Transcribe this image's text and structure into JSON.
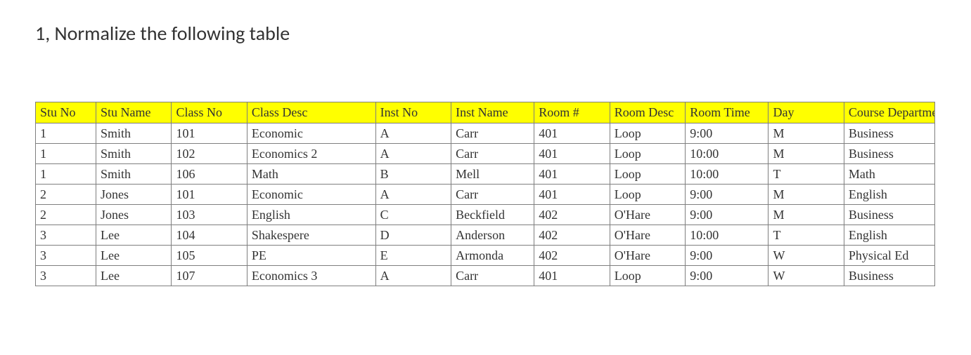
{
  "title": "1, Normalize the following table",
  "headers": [
    "Stu No",
    "Stu Name",
    "Class No",
    "Class Desc",
    "Inst No",
    "Inst Name",
    "Room #",
    "Room Desc",
    "Room Time",
    "Day",
    "Course Department"
  ],
  "rows": [
    {
      "stu_no": "1",
      "stu_name": "Smith",
      "class_no": "101",
      "class_desc": "Economic",
      "inst_no": "A",
      "inst_name": "Carr",
      "room_num": "401",
      "room_desc": "Loop",
      "room_time": "9:00",
      "day": "M",
      "course_dept": "Business"
    },
    {
      "stu_no": "1",
      "stu_name": "Smith",
      "class_no": "102",
      "class_desc": "Economics 2",
      "inst_no": "A",
      "inst_name": "Carr",
      "room_num": "401",
      "room_desc": "Loop",
      "room_time": "10:00",
      "day": "M",
      "course_dept": "Business"
    },
    {
      "stu_no": "1",
      "stu_name": "Smith",
      "class_no": "106",
      "class_desc": "Math",
      "inst_no": "B",
      "inst_name": "Mell",
      "room_num": "401",
      "room_desc": "Loop",
      "room_time": "10:00",
      "day": "T",
      "course_dept": "Math"
    },
    {
      "stu_no": "2",
      "stu_name": "Jones",
      "class_no": "101",
      "class_desc": "Economic",
      "inst_no": "A",
      "inst_name": "Carr",
      "room_num": "401",
      "room_desc": "Loop",
      "room_time": "9:00",
      "day": "M",
      "course_dept": "English"
    },
    {
      "stu_no": "2",
      "stu_name": "Jones",
      "class_no": "103",
      "class_desc": "English",
      "inst_no": "C",
      "inst_name": "Beckfield",
      "room_num": "402",
      "room_desc": "O'Hare",
      "room_time": "9:00",
      "day": "M",
      "course_dept": "Business"
    },
    {
      "stu_no": "3",
      "stu_name": "Lee",
      "class_no": "104",
      "class_desc": "Shakespere",
      "inst_no": "D",
      "inst_name": "Anderson",
      "room_num": "402",
      "room_desc": "O'Hare",
      "room_time": "10:00",
      "day": "T",
      "course_dept": "English"
    },
    {
      "stu_no": "3",
      "stu_name": "Lee",
      "class_no": "105",
      "class_desc": "PE",
      "inst_no": "E",
      "inst_name": "Armonda",
      "room_num": "402",
      "room_desc": "O'Hare",
      "room_time": "9:00",
      "day": "W",
      "course_dept": "Physical Ed"
    },
    {
      "stu_no": "3",
      "stu_name": "Lee",
      "class_no": "107",
      "class_desc": "Economics 3",
      "inst_no": "A",
      "inst_name": "Carr",
      "room_num": "401",
      "room_desc": "Loop",
      "room_time": "9:00",
      "day": "W",
      "course_dept": "Business"
    }
  ],
  "chart_data": {
    "type": "table",
    "title": "Normalize the following table",
    "columns": [
      "Stu No",
      "Stu Name",
      "Class No",
      "Class Desc",
      "Inst No",
      "Inst Name",
      "Room #",
      "Room Desc",
      "Room Time",
      "Day",
      "Course Department"
    ],
    "data": [
      [
        "1",
        "Smith",
        "101",
        "Economic",
        "A",
        "Carr",
        "401",
        "Loop",
        "9:00",
        "M",
        "Business"
      ],
      [
        "1",
        "Smith",
        "102",
        "Economics 2",
        "A",
        "Carr",
        "401",
        "Loop",
        "10:00",
        "M",
        "Business"
      ],
      [
        "1",
        "Smith",
        "106",
        "Math",
        "B",
        "Mell",
        "401",
        "Loop",
        "10:00",
        "T",
        "Math"
      ],
      [
        "2",
        "Jones",
        "101",
        "Economic",
        "A",
        "Carr",
        "401",
        "Loop",
        "9:00",
        "M",
        "English"
      ],
      [
        "2",
        "Jones",
        "103",
        "English",
        "C",
        "Beckfield",
        "402",
        "O'Hare",
        "9:00",
        "M",
        "Business"
      ],
      [
        "3",
        "Lee",
        "104",
        "Shakespere",
        "D",
        "Anderson",
        "402",
        "O'Hare",
        "10:00",
        "T",
        "English"
      ],
      [
        "3",
        "Lee",
        "105",
        "PE",
        "E",
        "Armonda",
        "402",
        "O'Hare",
        "9:00",
        "W",
        "Physical Ed"
      ],
      [
        "3",
        "Lee",
        "107",
        "Economics 3",
        "A",
        "Carr",
        "401",
        "Loop",
        "9:00",
        "W",
        "Business"
      ]
    ]
  }
}
